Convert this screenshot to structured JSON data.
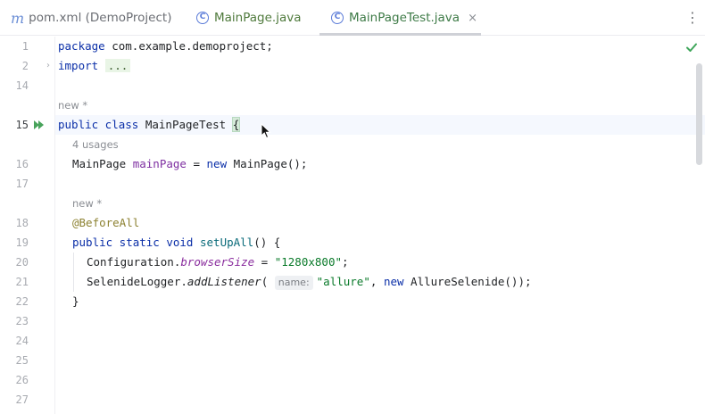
{
  "tabs": [
    {
      "icon": "maven-icon",
      "label": "pom.xml (DemoProject)"
    },
    {
      "icon": "class-icon",
      "label": "MainPage.java"
    },
    {
      "icon": "class-icon",
      "label": "MainPageTest.java",
      "close": "×"
    }
  ],
  "more_menu": "⋮",
  "lines": [
    {
      "num": "1",
      "tokens": [
        {
          "t": "package ",
          "c": "kw"
        },
        {
          "t": "com.example.demoproject;",
          "c": ""
        }
      ]
    },
    {
      "num": "2",
      "tokens": [
        {
          "t": "import",
          "c": "kw"
        },
        {
          "t": " ",
          "c": ""
        },
        {
          "t": "...",
          "c": "folded"
        }
      ]
    },
    {
      "num": "14"
    },
    {
      "hint": "new *"
    },
    {
      "num": "15",
      "current": true,
      "tokens": [
        {
          "t": "public class ",
          "c": "kw"
        },
        {
          "t": "MainPageTest ",
          "c": ""
        },
        {
          "t": "{",
          "c": "brace-hl"
        }
      ]
    },
    {
      "hint": "4 usages"
    },
    {
      "num": "16",
      "tokens": [
        {
          "t": "MainPage ",
          "c": ""
        },
        {
          "t": "mainPage",
          "c": "field"
        },
        {
          "t": " = ",
          "c": ""
        },
        {
          "t": "new ",
          "c": "kw"
        },
        {
          "t": "MainPage();",
          "c": ""
        }
      ]
    },
    {
      "num": "17"
    },
    {
      "hint": "new *"
    },
    {
      "num": "18",
      "tokens": [
        {
          "t": "@BeforeAll",
          "c": "ann"
        }
      ]
    },
    {
      "num": "19",
      "tokens": [
        {
          "t": "public static void ",
          "c": "kw"
        },
        {
          "t": "setUpAll",
          "c": "method-decl"
        },
        {
          "t": "() {",
          "c": ""
        }
      ]
    },
    {
      "num": "20",
      "tokens": [
        {
          "t": "Configuration.",
          "c": ""
        },
        {
          "t": "browserSize",
          "c": "static-field"
        },
        {
          "t": " = ",
          "c": ""
        },
        {
          "t": "\"1280x800\"",
          "c": "str"
        },
        {
          "t": ";",
          "c": ""
        }
      ]
    },
    {
      "num": "21",
      "tokens": [
        {
          "t": "SelenideLogger.",
          "c": ""
        },
        {
          "t": "addListener",
          "c": "static-italic"
        },
        {
          "t": "( ",
          "c": ""
        },
        {
          "t": "name:",
          "c": "param-hint"
        },
        {
          "t": "\"allure\"",
          "c": "str"
        },
        {
          "t": ", ",
          "c": ""
        },
        {
          "t": "new ",
          "c": "kw"
        },
        {
          "t": "AllureSelenide());",
          "c": ""
        }
      ]
    },
    {
      "num": "22",
      "tokens": [
        {
          "t": "}",
          "c": ""
        }
      ]
    },
    {
      "num": "23"
    },
    {
      "num": "24"
    },
    {
      "num": "25"
    },
    {
      "num": "26"
    },
    {
      "num": "27"
    }
  ]
}
